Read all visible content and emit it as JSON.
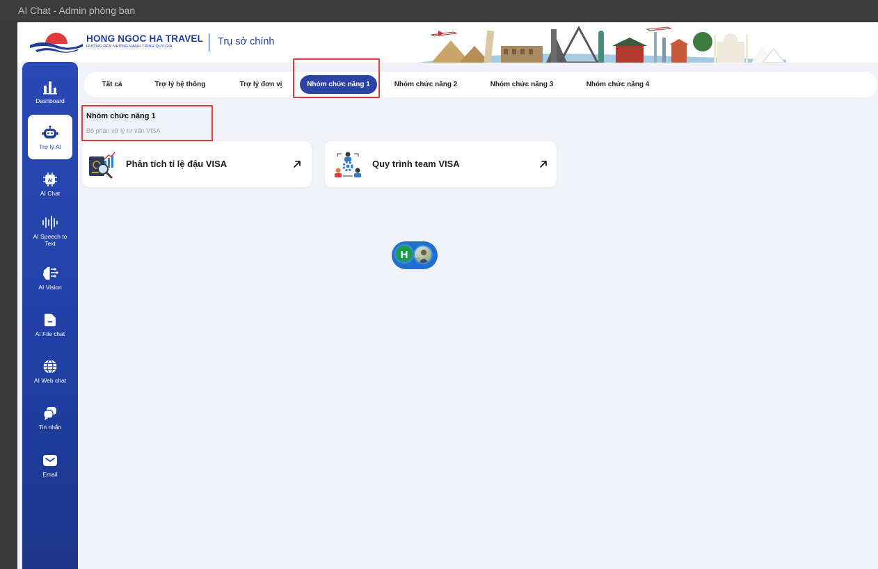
{
  "window": {
    "title": "AI Chat - Admin phòng ban"
  },
  "brand": {
    "name": "HONG NGOC HA TRAVEL",
    "slogan": "HƯỚNG ĐẾN NHỮNG HÀNH TRÌNH QUÝ GIÁ",
    "branch": "Trụ sở  chính"
  },
  "sidebar": {
    "items": [
      {
        "label": "Dashboard",
        "icon": "bar-chart-icon"
      },
      {
        "label": "Trợ lý AI",
        "icon": "robot-icon",
        "active": true
      },
      {
        "label": "AI Chat",
        "icon": "ai-chip-icon"
      },
      {
        "label": "AI Speech to",
        "label2": "Text",
        "icon": "sound-wave-icon"
      },
      {
        "label": "AI Vision",
        "icon": "brain-icon"
      },
      {
        "label": "AI File chat",
        "icon": "file-icon"
      },
      {
        "label": "AI Web chat",
        "icon": "globe-icon"
      },
      {
        "label": "Tin nhắn",
        "icon": "chat-bubbles-icon"
      },
      {
        "label": "Email",
        "icon": "mail-icon"
      }
    ]
  },
  "tabs": [
    {
      "label": "Tất cả"
    },
    {
      "label": "Trợ lý hệ thống"
    },
    {
      "label": "Trợ lý đơn vị"
    },
    {
      "label": "Nhóm chức năng 1",
      "active": true
    },
    {
      "label": "Nhóm chức năng 2"
    },
    {
      "label": "Nhóm chức năng 3"
    },
    {
      "label": "Nhóm chức năng 4"
    }
  ],
  "group": {
    "title": "Nhóm chức năng 1",
    "subtitle": "Bộ phận xử lý tư vấn VISA"
  },
  "cards": [
    {
      "title": "Phân tích tỉ lệ đậu VISA",
      "icon": "passport-analysis-icon"
    },
    {
      "title": "Quy trình team VISA",
      "icon": "team-process-icon"
    }
  ],
  "avatars": {
    "initial": "H"
  },
  "colors": {
    "primary": "#2c43a5",
    "highlight": "#e0393e",
    "background": "#f0f2f7"
  }
}
